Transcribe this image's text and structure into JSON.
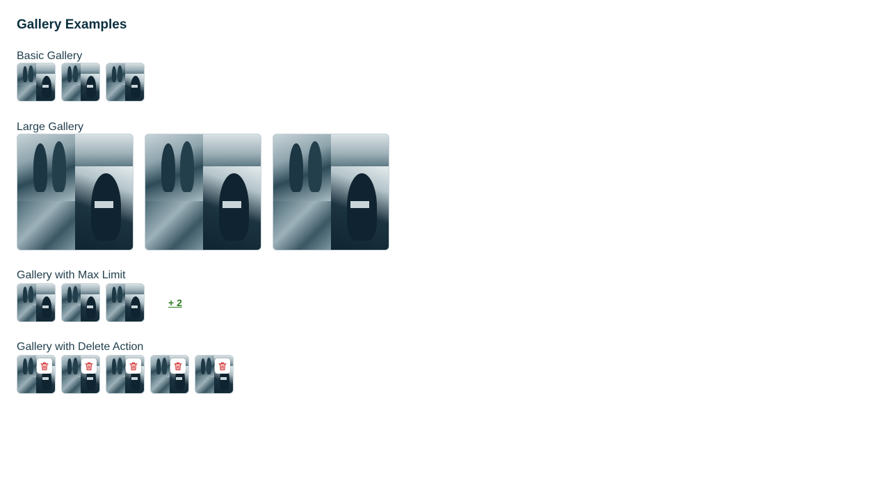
{
  "page_title": "Gallery Examples",
  "sections": {
    "basic": {
      "title": "Basic Gallery",
      "image_count": 3
    },
    "large": {
      "title": "Large Gallery",
      "image_count": 3
    },
    "max_limit": {
      "title": "Gallery with Max Limit",
      "image_count": 3,
      "more_label": "+ 2"
    },
    "delete": {
      "title": "Gallery with Delete Action",
      "image_count": 5
    }
  },
  "colors": {
    "heading": "#0b2f3f",
    "link_green": "#2e7d22",
    "delete_red": "#d32f2f",
    "thumb_border": "#c9d4d9"
  },
  "icons": {
    "delete": "trash-icon"
  }
}
